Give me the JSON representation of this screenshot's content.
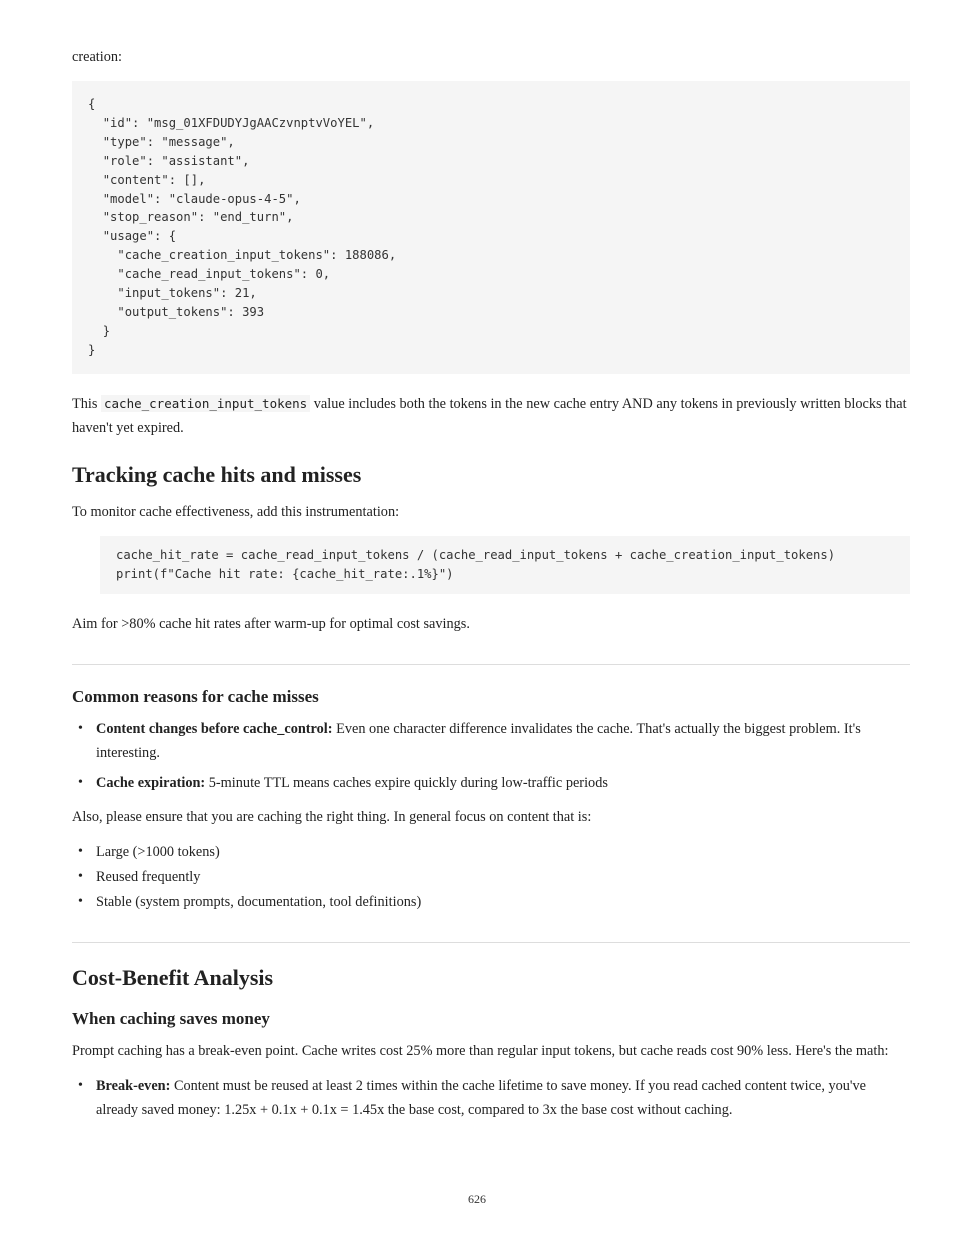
{
  "intro": "creation:",
  "code1": "{\n  \"id\": \"msg_01XFDUDYJgAACzvnptvVoYEL\",\n  \"type\": \"message\",\n  \"role\": \"assistant\",\n  \"content\": [],\n  \"model\": \"claude-opus-4-5\",\n  \"stop_reason\": \"end_turn\",\n  \"usage\": {\n    \"cache_creation_input_tokens\": 188086,\n    \"cache_read_input_tokens\": 0,\n    \"input_tokens\": 21,\n    \"output_tokens\": 393\n  }\n}",
  "para1_a": "This ",
  "para1_code": "cache_creation_input_tokens",
  "para1_b": " value includes both the tokens in the new cache entry AND any tokens in previously written blocks that haven't yet expired.",
  "h2": "Tracking cache hits and misses",
  "para2": "To monitor cache effectiveness, add this instrumentation:",
  "code2": "cache_hit_rate = cache_read_input_tokens / (cache_read_input_tokens + cache_creation_input_tokens)\nprint(f\"Cache hit rate: {cache_hit_rate:.1%}\")",
  "para3": "Aim for >80% cache hit rates after warm-up for optimal cost savings.",
  "h3_1": "Common reasons for cache misses",
  "bullets1": [
    {
      "b": "Content changes before cache_control:",
      "t": " Even one character difference invalidates the cache. That's actually the biggest problem. It's interesting."
    },
    {
      "b": "Cache expiration:",
      "t": " 5-minute TTL means caches expire quickly during low-traffic periods"
    }
  ],
  "para4": "Also, please ensure that you are caching the right thing. In general focus on content that is:",
  "bullets2": [
    "Large (>1000 tokens)",
    "Reused frequently",
    "Stable (system prompts, documentation, tool definitions)"
  ],
  "h2_2": "Cost-Benefit Analysis",
  "h3_2": "When caching saves money",
  "para5": "Prompt caching has a break-even point. Cache writes cost 25% more than regular input tokens, but cache reads cost 90% less. Here's the math:",
  "bullets3_b": "Break-even:",
  "bullets3_t": " Content must be reused at least 2 times within the cache lifetime to save money. If you read cached content twice, you've already saved money: 1.25x + 0.1x + 0.1x = 1.45x the base cost, compared to 3x the base cost without caching.",
  "page_number": "626"
}
